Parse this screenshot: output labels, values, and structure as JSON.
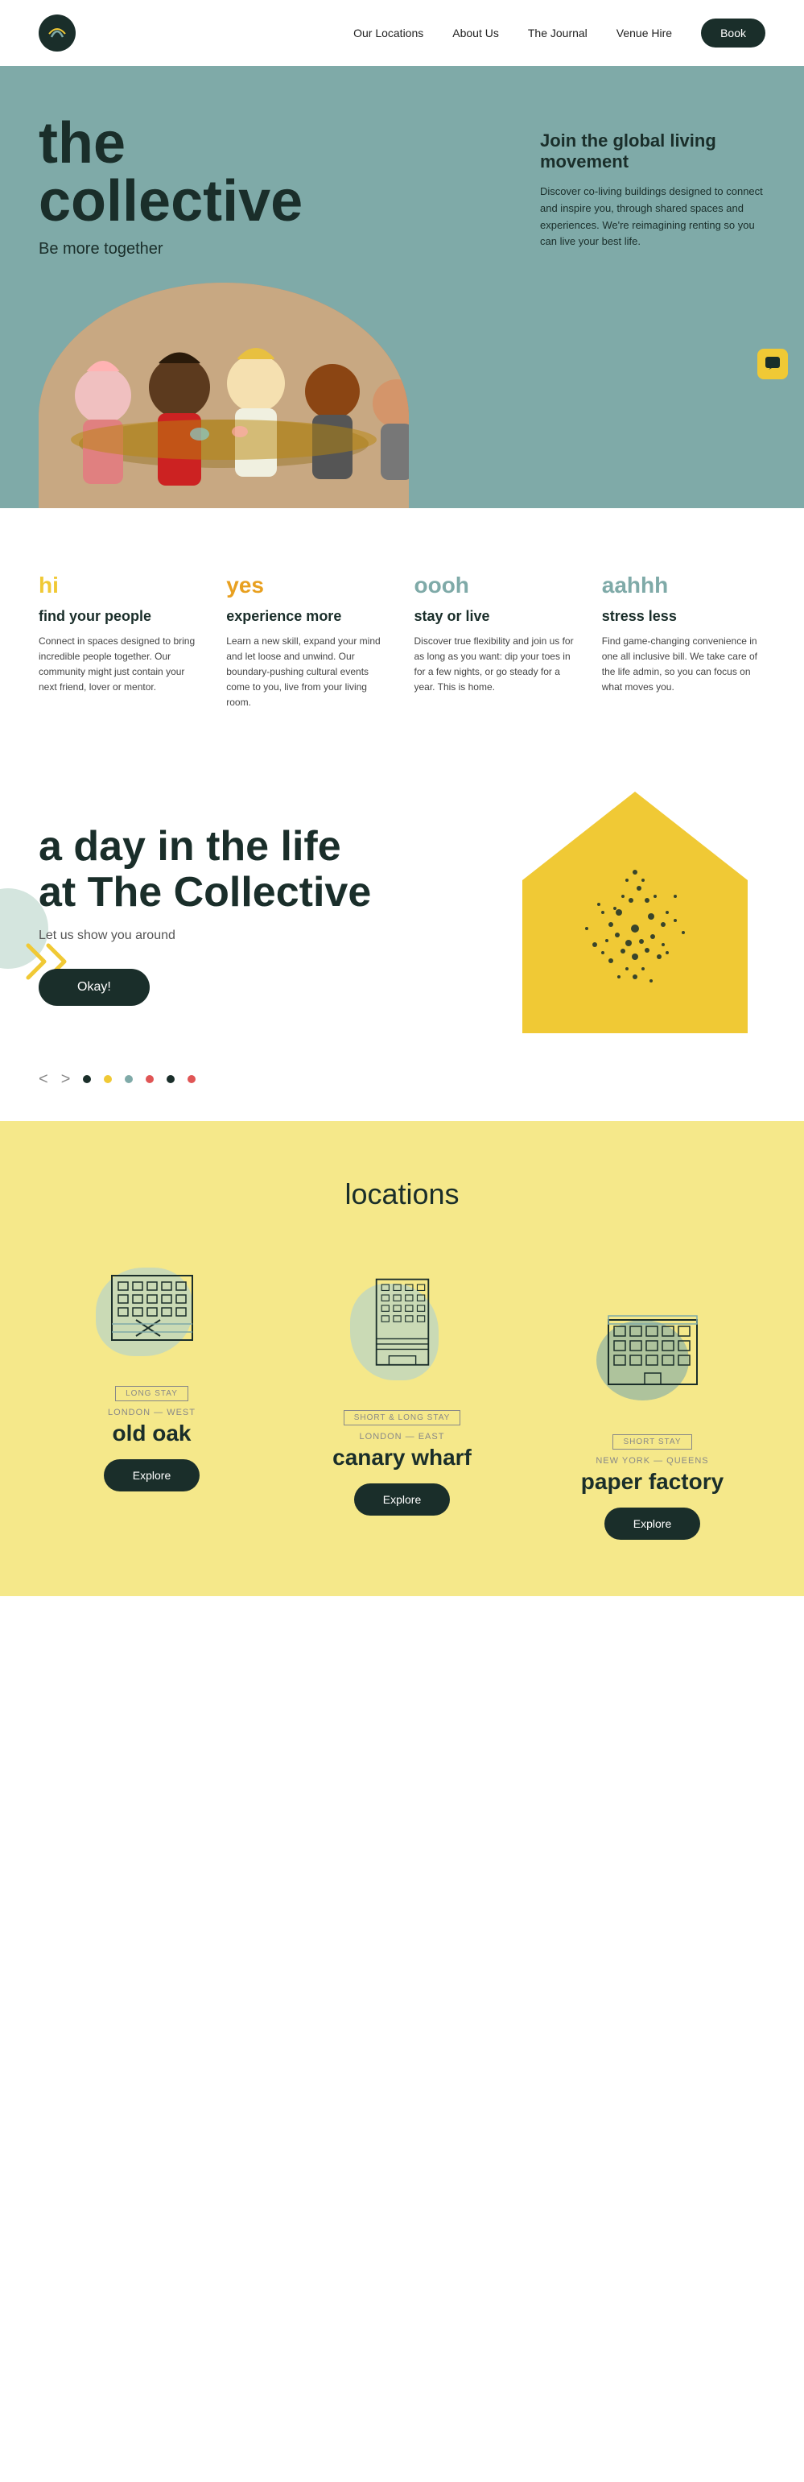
{
  "nav": {
    "logo_alt": "The Collective logo",
    "links": [
      {
        "label": "Our Locations",
        "href": "#"
      },
      {
        "label": "About Us",
        "href": "#"
      },
      {
        "label": "The Journal",
        "href": "#"
      },
      {
        "label": "Venue Hire",
        "href": "#"
      }
    ],
    "book_label": "Book"
  },
  "hero": {
    "title_line1": "the",
    "title_line2": "collective",
    "subtitle": "Be more together",
    "tagline": "Join the global living movement",
    "description": "Discover co-living buildings designed to connect and inspire you, through shared spaces and experiences. We're reimagining renting so you can live your best life."
  },
  "features": {
    "items": [
      {
        "word": "hi",
        "word_class": "hi",
        "title": "find your people",
        "desc": "Connect in spaces designed to bring incredible people together. Our community might just contain your next friend, lover or mentor."
      },
      {
        "word": "yes",
        "word_class": "yes",
        "title": "experience more",
        "desc": "Learn a new skill, expand your mind and let loose and unwind. Our boundary-pushing cultural events come to you, live from your living room."
      },
      {
        "word": "oooh",
        "word_class": "oooh",
        "title": "stay or live",
        "desc": "Discover true flexibility and join us for as long as you want: dip your toes in for a few nights, or go steady for a year. This is home."
      },
      {
        "word": "aahhh",
        "word_class": "aahhh",
        "title": "stress less",
        "desc": "Find game-changing convenience in one all inclusive bill. We take care of the life admin, so you can focus on what moves you."
      }
    ]
  },
  "day_life": {
    "title_line1": "a day in the life",
    "title_line2": "at The Collective",
    "subtitle": "Let us show you around",
    "cta_label": "Okay!"
  },
  "carousel": {
    "prev_label": "<",
    "next_label": ">",
    "dots": [
      {
        "color": "#1a2e2a",
        "active": true
      },
      {
        "color": "#f0c935",
        "active": false
      },
      {
        "color": "#7faaa8",
        "active": false
      },
      {
        "color": "#e05555",
        "active": false
      },
      {
        "color": "#1a2e2a",
        "active": false
      },
      {
        "color": "#e05555",
        "active": false
      }
    ]
  },
  "locations": {
    "section_title": "locations",
    "items": [
      {
        "badge": "LONG STAY",
        "region": "LONDON — WEST",
        "name": "old oak",
        "cta": "Explore",
        "blob_color": "#b8d4c8",
        "offset": "0"
      },
      {
        "badge": "SHORT & LONG STAY",
        "region": "LONDON — EAST",
        "name": "canary wharf",
        "cta": "Explore",
        "blob_color": "#b8d4c8",
        "offset": "30"
      },
      {
        "badge": "SHORT STAY",
        "region": "NEW YORK — QUEENS",
        "name": "paper factory",
        "cta": "Explore",
        "blob_color": "#7faaa8",
        "offset": "60"
      }
    ]
  }
}
